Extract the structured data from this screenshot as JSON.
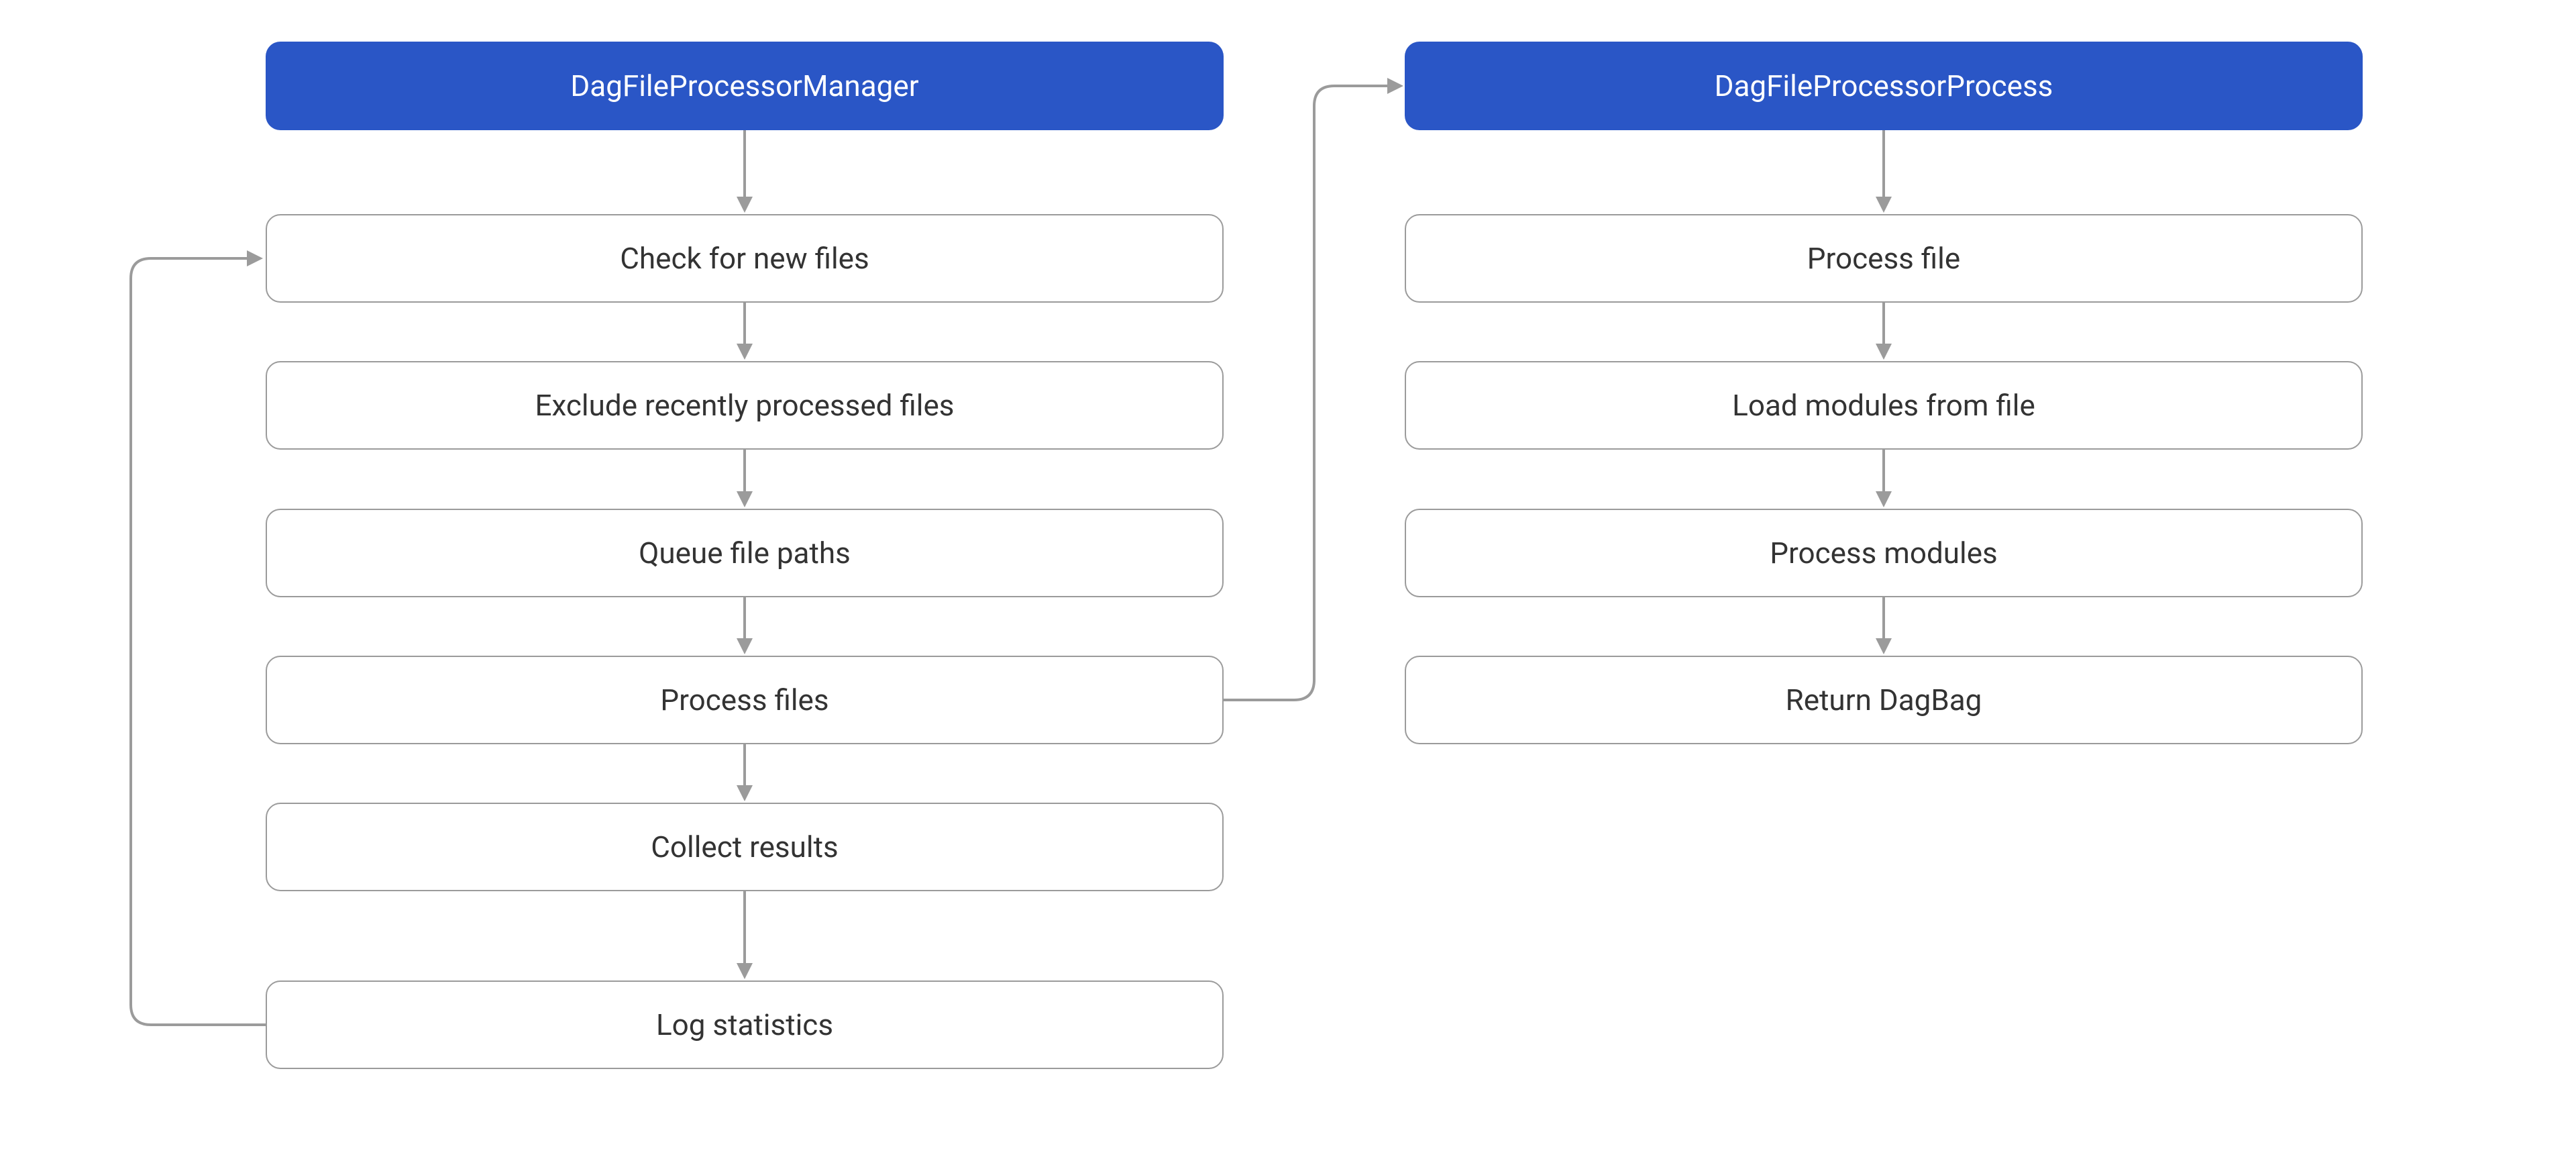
{
  "diagram": {
    "left": {
      "header": "DagFileProcessorManager",
      "steps": [
        "Check for new files",
        "Exclude recently processed files",
        "Queue file paths",
        "Process files",
        "Collect results",
        "Log statistics"
      ]
    },
    "right": {
      "header": "DagFileProcessorProcess",
      "steps": [
        "Process file",
        "Load modules from file",
        "Process modules",
        "Return DagBag"
      ]
    }
  },
  "colors": {
    "header_bg": "#2a56c6",
    "border": "#9b9b9b"
  }
}
